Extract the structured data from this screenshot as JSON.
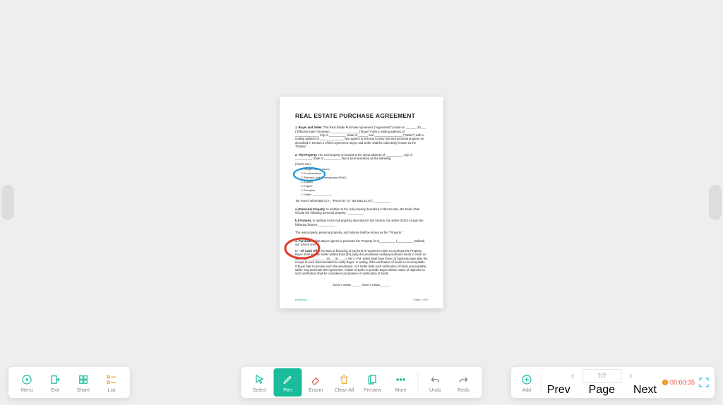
{
  "document": {
    "title": "REAL ESTATE PURCHASE AGREEMENT",
    "sec1_label": "1. Buyer and Seller.",
    "sec1_text": " This Real Estate Purchase Agreement (\"Agreement\") made on ______, 20___ (\"Effective Date\") between _________________ (\"Buyer\") with a mailing address of ______________, City of __________, State of ______ and _________________ (\"Seller\") with a mailing address of ______________, who agrees to sell and convey real and personal property as described in Section 2 of this Agreement. Buyer and Seller shall be collectively known as the \"Parties.\"",
    "sec2_label": "2. The Property.",
    "sec2_text": " The real property is located at the street address of __________, City of __________, State of __________ that is best described as the following:",
    "check_one": "(check one)",
    "property_types": [
      "Single-Family Home",
      "Condominium",
      "Planned Unit Development (PUD)",
      "Duplex",
      "Triplex",
      "Fourplex",
      "Other: ____________"
    ],
    "parcel_line": "Tax Parcel Information (i.e., \"Parcel ID\" or \"Tax Map & Lot\"): __________",
    "seca_label": "a.) Personal Property.",
    "seca_text": " In addition to the real property described in this Section, the Seller shall include the following personal property: __________",
    "secb_label": "b.) Fixtures.",
    "secb_text": " In addition to the real property described in this Section, the Seller DOES include the following fixtures: __________",
    "prop_line": "The real property, personal property, and fixtures shall be known as the \"Property.\"",
    "sec3_label": "3. Purchase Price.",
    "sec3_text": " Buyer agrees to purchase the Property for $__________ (__________ Dollars) via: (check one)",
    "cash_label": "☐ - All Cash Offer.",
    "cash_text": " No loan or financing of any kind is required in order to purchase the Property. Buyer shall provide Seller written third (3ʳᵈ) party documentation verifying sufficient funds to close no later than __________, 20___ at ___ ☐ AM ☐ PM. Seller shall have three (3) business days after the receipt of such documentation to notify Buyer, in writing, if the verification of funds is not acceptable. If Buyer fails to provide such documentation, or if Seller finds such verification of funds unacceptable, Seller may terminate this Agreement. Failure of Seller to provide Buyer written notice of objection to such verification shall be considered acceptance of verification of funds.",
    "initials": "Buyer's Initials ______   Seller's Initials ______",
    "brand": "freeforms",
    "page_label": "Page 1 of 9"
  },
  "left_toolbar": {
    "menu": "Menu",
    "exit": "Exit",
    "share": "Share",
    "list": "List"
  },
  "center_toolbar": {
    "select": "Select",
    "pen": "Pen",
    "eraser": "Eraser",
    "clean": "Clean All",
    "preview": "Preview",
    "more": "More",
    "undo": "Undo",
    "redo": "Redo"
  },
  "right_toolbar": {
    "add": "Add",
    "prev": "Prev",
    "page_display": "7/7",
    "page_label": "Page",
    "next": "Next",
    "timer": "00:00:35"
  }
}
